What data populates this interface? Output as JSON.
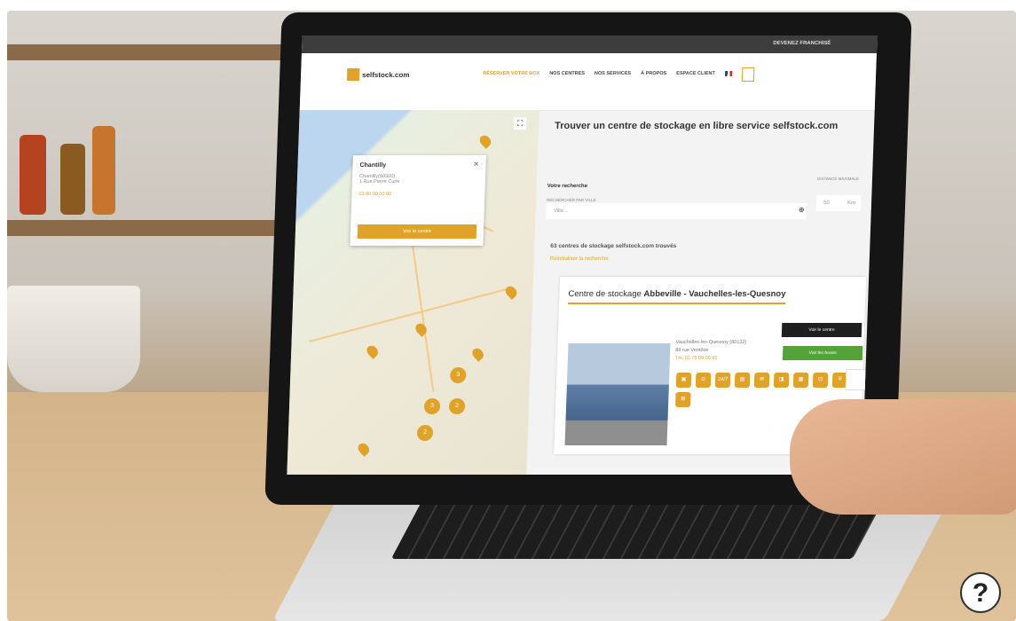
{
  "topbar": {
    "label": "DEVENEZ FRANCHISÉ"
  },
  "nav": {
    "logo": "selfstock.com",
    "items": [
      "RÉSERVER VOTRE BOX",
      "NOS CENTRES",
      "NOS SERVICES",
      "À PROPOS",
      "ESPACE CLIENT"
    ]
  },
  "popup": {
    "title": "Chantilly",
    "line1": "Chantilly(60500)",
    "line2": "1 Rue Pierre Curie",
    "phone": "03 00 00 00 00",
    "button": "Voir le centre",
    "close": "×"
  },
  "map": {
    "clusters": [
      "3",
      "3",
      "2",
      "2"
    ]
  },
  "panel": {
    "heading": "Trouver un centre de stockage en libre service selfstock.com",
    "label_search": "Votre recherche",
    "label_city": "RECHERCHER PAR VILLE",
    "label_distance": "DISTANCE MAXIMALE",
    "search_placeholder": "Ville...",
    "distance_value": "50",
    "distance_unit": "Km",
    "found": "63 centres de stockage selfstock.com trouvés",
    "refine": "Réinitialiser la recherche"
  },
  "card": {
    "title_prefix": "Centre de stockage",
    "title_name": "Abbeville - Vauchelles-les-Quesnoy",
    "addr1": "Vauchelles-les-Quesnoy (80132)",
    "addr2": "89 rue Ventôse",
    "tel": "Tél. 03 75 09 00 95",
    "btn_dark": "Voir le centre",
    "btn_green": "Voir les boxes",
    "icons": [
      "▣",
      "⊙",
      "24/7",
      "▤",
      "✉",
      "◨",
      "▦",
      "⊡",
      "⛨",
      "⊞"
    ]
  },
  "help": {
    "label": "?"
  }
}
